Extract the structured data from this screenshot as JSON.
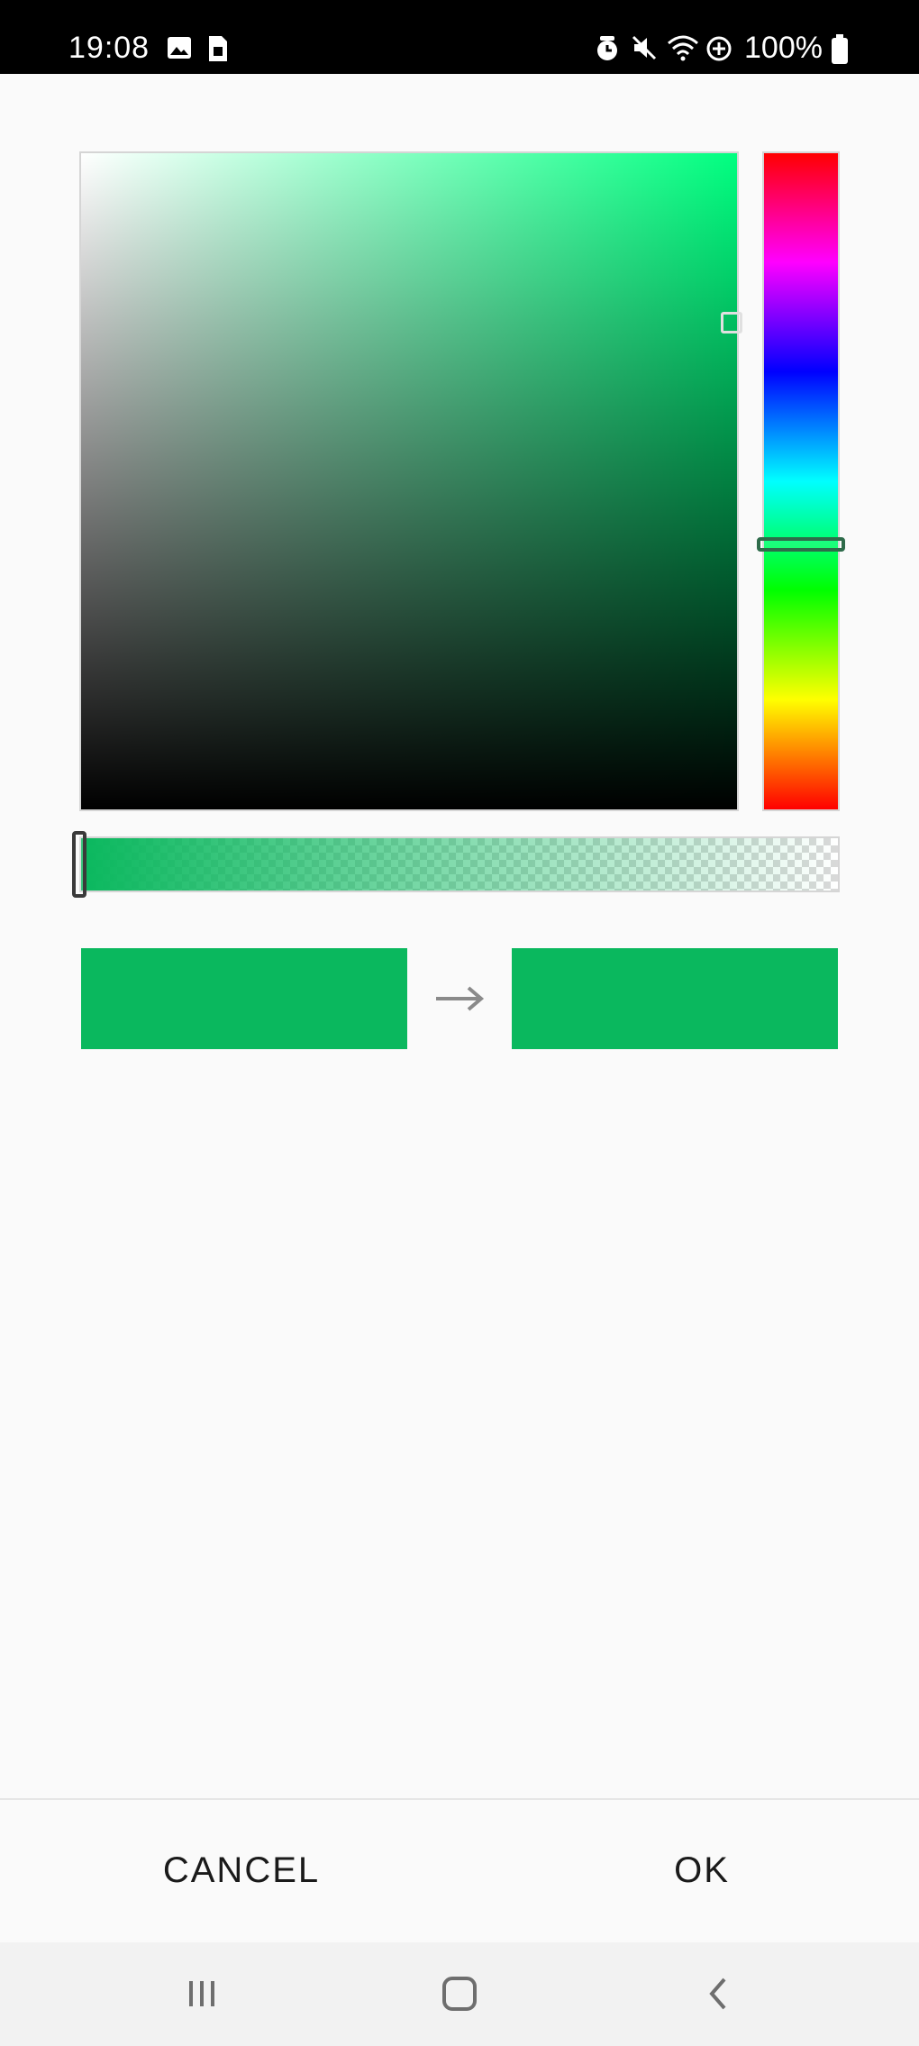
{
  "status_bar": {
    "time": "19:08",
    "battery": "100%",
    "icons": [
      "gallery-icon",
      "sim-icon",
      "alarm-icon",
      "mute-icon",
      "wifi-icon",
      "data-saver-icon",
      "battery-icon"
    ]
  },
  "color_picker": {
    "selected_hue_color": "#00ff80",
    "current_color": "#0ab85e",
    "previous_color": "#0ab85e",
    "alpha": 1.0,
    "arrow_icon": "arrow-right-icon"
  },
  "dialog": {
    "cancel_label": "CANCEL",
    "ok_label": "OK"
  },
  "nav_bar": {
    "icons": [
      "recents-icon",
      "home-icon",
      "back-icon"
    ]
  }
}
